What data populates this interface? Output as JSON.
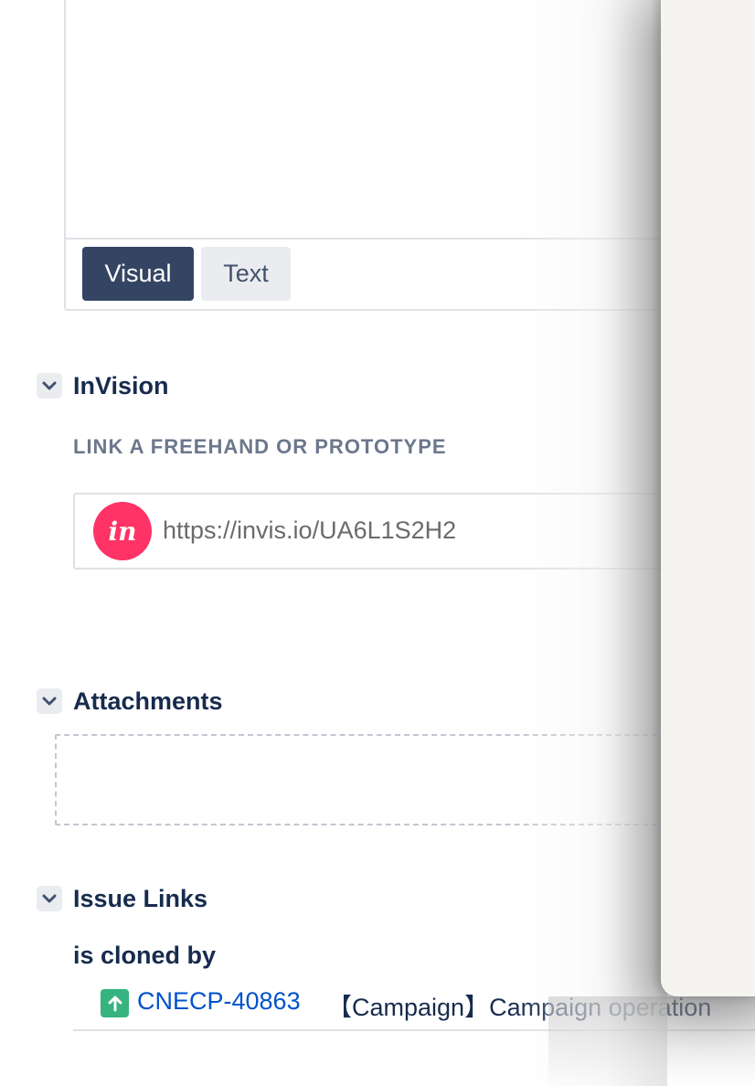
{
  "editor": {
    "mode_visual_label": "Visual",
    "mode_text_label": "Text",
    "active_mode": "Visual"
  },
  "invision": {
    "title": "InVision",
    "subheading": "LINK A FREEHAND OR PROTOTYPE",
    "logo_text": "in",
    "link_value": "https://invis.io/UA6L1S2H2"
  },
  "attachments": {
    "title": "Attachments"
  },
  "issue_links": {
    "title": "Issue Links",
    "relation": "is cloned by",
    "items": [
      {
        "key": "CNECP-40863",
        "summary": "【Campaign】Campaign operation",
        "type_icon": "story-arrow-up-icon"
      }
    ]
  },
  "colors": {
    "accent_dark": "#344563",
    "link_blue": "#0052cc",
    "invision_pink": "#ff3366",
    "issue_type_green": "#36b37e"
  }
}
